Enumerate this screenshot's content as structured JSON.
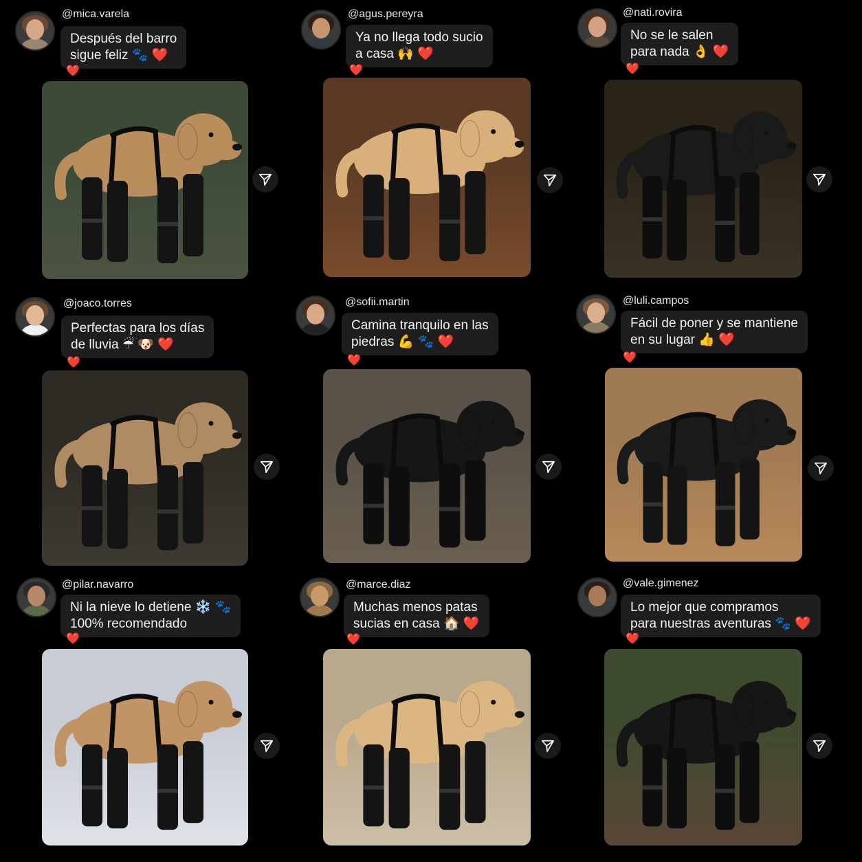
{
  "posts": [
    {
      "handle": "@mica.varela",
      "lines": [
        "Después del barro",
        "sigue feliz 🐾 ❤️"
      ],
      "reaction": "❤️",
      "photo_icon": "golden-dog-in-mud-photo",
      "send_icon": "send-icon",
      "colors": {
        "bg": "#3d4a38",
        "ground": "#4b5440",
        "dog": "#b98e5c",
        "boots": "#141414",
        "skin": "#d7a888",
        "hair": "#6a4a32",
        "shirt": "#9a8570"
      }
    },
    {
      "handle": "@agus.pereyra",
      "lines": [
        "Ya no llega todo sucio",
        "a casa 🙌 ❤️"
      ],
      "reaction": "❤️",
      "photo_icon": "labrador-on-wood-floor-photo",
      "send_icon": "send-icon",
      "colors": {
        "bg": "#5a3a24",
        "ground": "#7a4b2c",
        "dog": "#d9b07a",
        "boots": "#141414",
        "skin": "#c8966e",
        "hair": "#2c2018",
        "shirt": "#2f3a45"
      }
    },
    {
      "handle": "@nati.rovira",
      "lines": [
        "No se le salen",
        "para nada 👌 ❤️"
      ],
      "reaction": "❤️",
      "photo_icon": "border-collie-night-rain-photo",
      "send_icon": "send-icon",
      "colors": {
        "bg": "#2a2418",
        "ground": "#3a3224",
        "dog": "#1a1a1a",
        "boots": "#0e0e0e",
        "skin": "#d4a282",
        "hair": "#4a3222",
        "shirt": "#5a4a3a"
      }
    },
    {
      "handle": "@joaco.torres",
      "lines": [
        "Perfectas para los días",
        "de lluvia ☔ 🐶 ❤️"
      ],
      "reaction": "❤️",
      "photo_icon": "golden-dog-in-rain-puddle-photo",
      "send_icon": "send-icon",
      "colors": {
        "bg": "#2e2a24",
        "ground": "#3e3a32",
        "dog": "#b08a62",
        "boots": "#141414",
        "skin": "#e0b898",
        "hair": "#6a4a30",
        "shirt": "#f0f0f0"
      }
    },
    {
      "handle": "@sofii.martin",
      "lines": [
        "Camina tranquilo en las",
        "piedras 💪 🐾 ❤️"
      ],
      "reaction": "❤️",
      "photo_icon": "border-collie-on-stones-photo",
      "send_icon": "send-icon",
      "colors": {
        "bg": "#5a5248",
        "ground": "#6a6050",
        "dog": "#161616",
        "boots": "#0e0e0e",
        "skin": "#d8a888",
        "hair": "#4a2e20",
        "shirt": "#222222"
      }
    },
    {
      "handle": "@luli.campos",
      "lines": [
        "Fácil de poner y se mantiene",
        "en su lugar 👍 ❤️"
      ],
      "reaction": "❤️",
      "photo_icon": "hands-fastening-dog-boot-photo",
      "send_icon": "send-icon",
      "colors": {
        "bg": "#a07a52",
        "ground": "#b8895a",
        "dog": "#1a1a1a",
        "boots": "#141414",
        "skin": "#d8b090",
        "hair": "#7a5a3e",
        "shirt": "#8a7a60"
      }
    },
    {
      "handle": "@pilar.navarro",
      "lines": [
        "Ni la nieve lo detiene ❄️ 🐾",
        "100% recomendado"
      ],
      "reaction": "❤️",
      "photo_icon": "golden-dog-in-snow-photo",
      "send_icon": "send-icon",
      "colors": {
        "bg": "#c8ccd4",
        "ground": "#dfe2e8",
        "dog": "#c09464",
        "boots": "#141414",
        "skin": "#b88868",
        "hair": "#2a2a2a",
        "shirt": "#5a6a4a"
      }
    },
    {
      "handle": "@marce.diaz",
      "lines": [
        "Muchas menos patas",
        "sucias en casa 🏠 ❤️"
      ],
      "reaction": "❤️",
      "photo_icon": "labrador-on-tile-floor-photo",
      "send_icon": "send-icon",
      "colors": {
        "bg": "#b8a88e",
        "ground": "#cdbfa6",
        "dog": "#dcb682",
        "boots": "#141414",
        "skin": "#c89a6a",
        "hair": "#8a6a3e",
        "shirt": "#a07a4a"
      }
    },
    {
      "handle": "@vale.gimenez",
      "lines": [
        "Lo mejor que compramos",
        "para nuestras aventuras 🐾 ❤️"
      ],
      "reaction": "❤️",
      "photo_icon": "dog-on-forest-trail-photo",
      "send_icon": "send-icon",
      "colors": {
        "bg": "#3e4a2e",
        "ground": "#5a4636",
        "dog": "#161616",
        "boots": "#0e0e0e",
        "skin": "#a87a5a",
        "hair": "#2a2018",
        "shirt": "#3a3a3a"
      }
    }
  ]
}
